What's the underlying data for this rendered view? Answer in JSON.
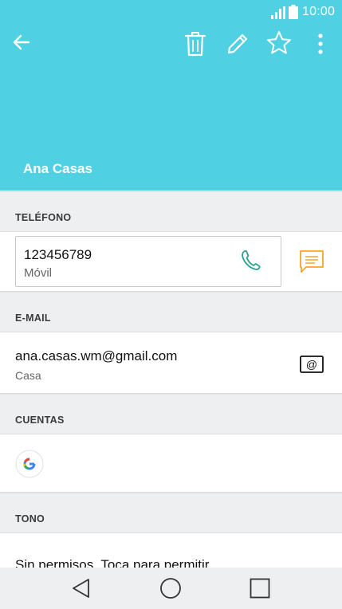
{
  "status_bar": {
    "time": "10:00"
  },
  "header": {
    "contact_name": "Ana Casas",
    "background_color": "#4fd1e3"
  },
  "sections": {
    "phone": {
      "title": "TELÉFONO",
      "number": "123456789",
      "type": "Móvil"
    },
    "email": {
      "title": "E-MAIL",
      "address": "ana.casas.wm@gmail.com",
      "type": "Casa"
    },
    "accounts": {
      "title": "CUENTAS"
    },
    "ringtone": {
      "title": "TONO",
      "value": "Sin permisos. Toca para permitir"
    }
  },
  "icons": {
    "back": "back-arrow-icon",
    "delete": "trash-icon",
    "edit": "pencil-icon",
    "favorite": "star-icon",
    "more": "more-vert-icon",
    "call": "phone-icon",
    "message": "message-icon",
    "email": "email-icon",
    "account": "google-icon"
  },
  "colors": {
    "accent": "#4fd1e3",
    "call_icon": "#2aa38f",
    "message_icon": "#f5a623"
  }
}
